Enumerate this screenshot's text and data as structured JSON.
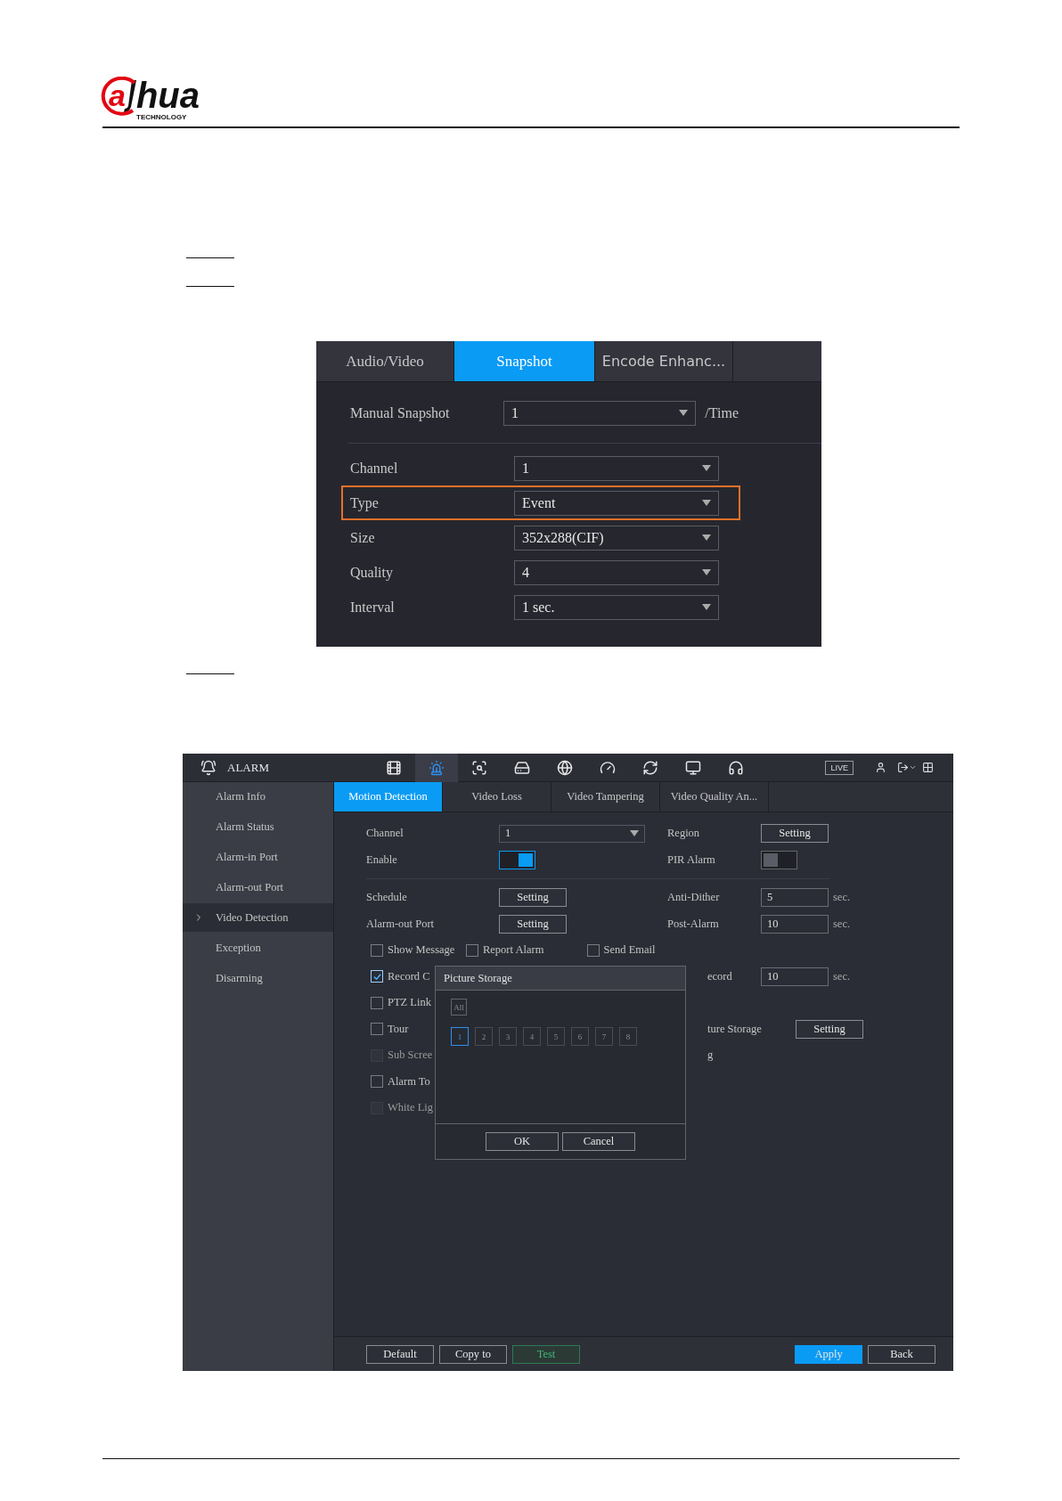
{
  "logo": {
    "mark": "a",
    "word": "hua",
    "tagline": "TECHNOLOGY"
  },
  "snapshot_screen": {
    "tabs": [
      {
        "label": "Audio/Video",
        "selected": false
      },
      {
        "label": "Snapshot",
        "selected": true
      },
      {
        "label": "Encode Enhanc...",
        "selected": false
      }
    ],
    "manual": {
      "label": "Manual Snapshot",
      "value": "1",
      "unit": "/Time"
    },
    "rows": [
      {
        "label": "Channel",
        "value": "1",
        "highlighted": false
      },
      {
        "label": "Type",
        "value": "Event",
        "highlighted": true
      },
      {
        "label": "Size",
        "value": "352x288(CIF)",
        "highlighted": false
      },
      {
        "label": "Quality",
        "value": "4",
        "highlighted": false
      },
      {
        "label": "Interval",
        "value": "1 sec.",
        "highlighted": false
      }
    ]
  },
  "alarm_screen": {
    "title": "ALARM",
    "menu_icons": [
      {
        "selected": false
      },
      {
        "selected": true
      },
      {
        "selected": false
      },
      {
        "selected": false
      },
      {
        "selected": false
      },
      {
        "selected": false
      },
      {
        "selected": false
      },
      {
        "selected": false
      },
      {
        "selected": false
      }
    ],
    "live": "LIVE",
    "sidebar": [
      {
        "label": "Alarm Info",
        "selected": false
      },
      {
        "label": "Alarm Status",
        "selected": false
      },
      {
        "label": "Alarm-in Port",
        "selected": false
      },
      {
        "label": "Alarm-out Port",
        "selected": false
      },
      {
        "label": "Video Detection",
        "selected": true
      },
      {
        "label": "Exception",
        "selected": false
      },
      {
        "label": "Disarming",
        "selected": false
      }
    ],
    "tabs": [
      {
        "label": "Motion Detection",
        "selected": true
      },
      {
        "label": "Video Loss",
        "selected": false
      },
      {
        "label": "Video Tampering",
        "selected": false
      },
      {
        "label": "Video Quality An...",
        "selected": false
      }
    ],
    "channel": {
      "label": "Channel",
      "value": "1"
    },
    "region": {
      "label": "Region",
      "button": "Setting"
    },
    "enable": {
      "label": "Enable",
      "on": true
    },
    "pir": {
      "label": "PIR Alarm",
      "on": false
    },
    "schedule": {
      "label": "Schedule",
      "button": "Setting"
    },
    "anti_dither": {
      "label": "Anti-Dither",
      "value": "5",
      "unit": "sec."
    },
    "alarm_out": {
      "label": "Alarm-out Port",
      "button": "Setting"
    },
    "post_alarm": {
      "label": "Post-Alarm",
      "value": "10",
      "unit": "sec."
    },
    "check_rows": [
      {
        "items": [
          {
            "label": "Show Message",
            "checked": false,
            "disabled": false
          },
          {
            "label": "Report Alarm",
            "checked": false,
            "disabled": false
          },
          {
            "label": "Send Email",
            "checked": false,
            "disabled": false
          }
        ]
      },
      {
        "items": [
          {
            "label": "Record C",
            "checked": true,
            "disabled": false
          }
        ],
        "right": {
          "kind": "field",
          "label": "ecord",
          "value": "10",
          "unit": "sec."
        }
      },
      {
        "items": [
          {
            "label": "PTZ Link",
            "checked": false,
            "disabled": false
          }
        ]
      },
      {
        "items": [
          {
            "label": "Tour",
            "checked": false,
            "disabled": false
          }
        ],
        "right": {
          "kind": "button",
          "label": "ture Storage",
          "button": "Setting"
        }
      },
      {
        "items": [
          {
            "label": "Sub Scree",
            "checked": false,
            "disabled": true
          }
        ],
        "right": {
          "kind": "text",
          "label": "g"
        }
      },
      {
        "items": [
          {
            "label": "Alarm To",
            "checked": false,
            "disabled": false
          }
        ]
      },
      {
        "items": [
          {
            "label": "White Lig",
            "checked": false,
            "disabled": true
          }
        ]
      }
    ],
    "dialog": {
      "title": "Picture Storage",
      "all": "All",
      "all_disabled": true,
      "channels": [
        {
          "label": "1",
          "selected": true
        },
        {
          "label": "2",
          "selected": false
        },
        {
          "label": "3",
          "selected": false
        },
        {
          "label": "4",
          "selected": false
        },
        {
          "label": "5",
          "selected": false
        },
        {
          "label": "6",
          "selected": false
        },
        {
          "label": "7",
          "selected": false
        },
        {
          "label": "8",
          "selected": false
        }
      ],
      "buttons": [
        "OK",
        "Cancel"
      ]
    },
    "footer": [
      {
        "label": "Default",
        "kind": "plain"
      },
      {
        "label": "Copy to",
        "kind": "plain"
      },
      {
        "label": "Test",
        "kind": "test"
      },
      {
        "label": "Apply",
        "kind": "primary"
      },
      {
        "label": "Back",
        "kind": "plain"
      }
    ]
  }
}
